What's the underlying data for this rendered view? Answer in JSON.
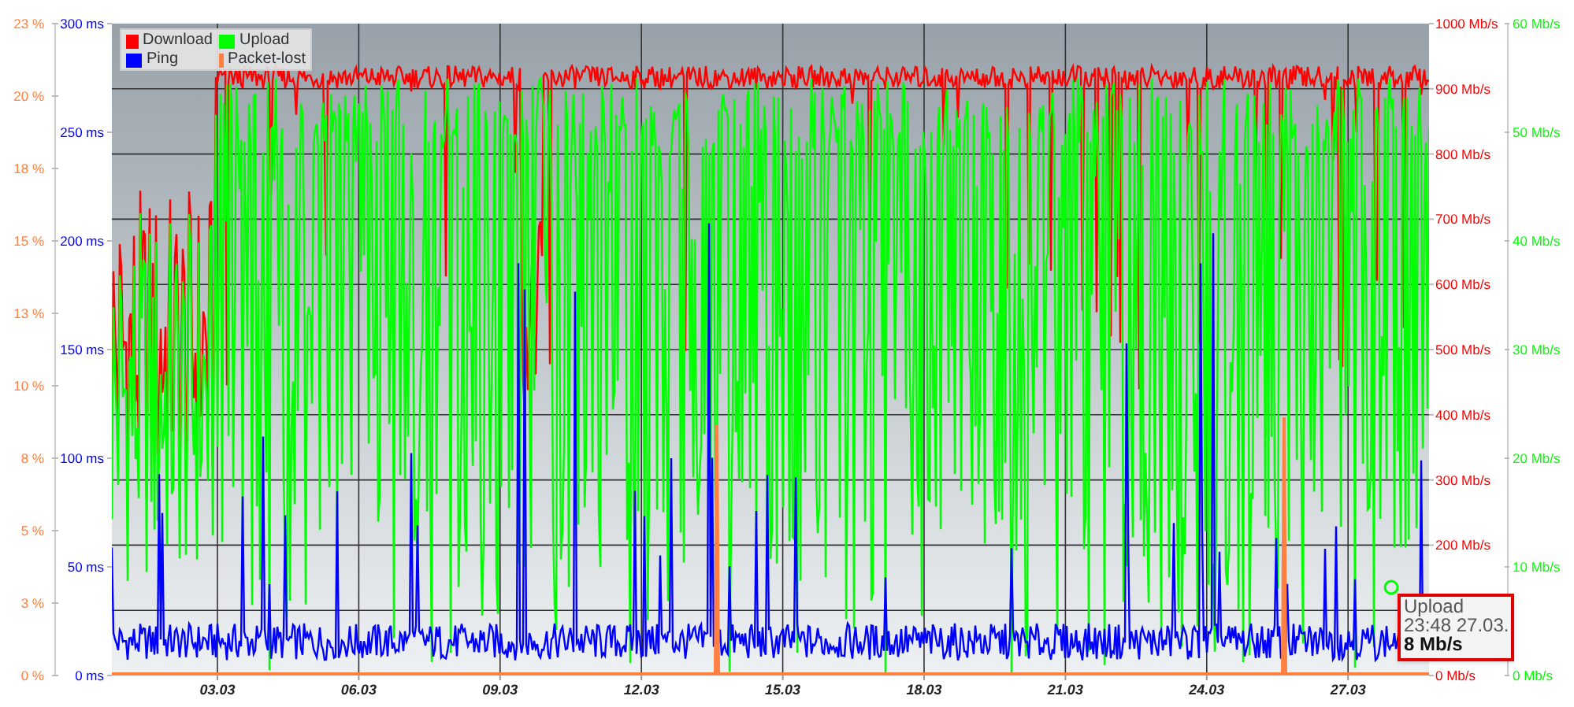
{
  "legend": [
    {
      "label": "Download",
      "color": "#ff0000"
    },
    {
      "label": "Upload",
      "color": "#00ff00"
    },
    {
      "label": "Ping",
      "color": "#0000ff"
    },
    {
      "label": "Packet-lost",
      "color": "#ff8040"
    }
  ],
  "axes": [
    {
      "kind": "left_outer",
      "color": "#ff8040",
      "ticks": [
        "23 %",
        "20 %",
        "18 %",
        "15 %",
        "13 %",
        "10 %",
        "8 %",
        "5 %",
        "3 %",
        "0 %"
      ]
    },
    {
      "kind": "left_inner",
      "color": "#0000ff",
      "ticks": [
        "300 ms",
        "250 ms",
        "200 ms",
        "150 ms",
        "100 ms",
        "50 ms",
        "0 ms"
      ]
    },
    {
      "kind": "right_inner",
      "color": "#ff0000",
      "ticks": [
        "1000 Mb/s",
        "900 Mb/s",
        "800 Mb/s",
        "700 Mb/s",
        "600 Mb/s",
        "500 Mb/s",
        "400 Mb/s",
        "300 Mb/s",
        "200 Mb/s",
        "0 Mb/s"
      ]
    },
    {
      "kind": "right_outer",
      "color": "#00ff00",
      "ticks": [
        "60 Mb/s",
        "50 Mb/s",
        "40 Mb/s",
        "30 Mb/s",
        "20 Mb/s",
        "10 Mb/s",
        "0 Mb/s"
      ]
    }
  ],
  "x_ticks": [
    "03.03",
    "06.03",
    "09.03",
    "12.03",
    "15.03",
    "18.03",
    "21.03",
    "24.03",
    "27.03"
  ],
  "tooltip": {
    "title": "Upload",
    "time": "23:48 27.03.",
    "value": "8 Mb/s"
  }
}
